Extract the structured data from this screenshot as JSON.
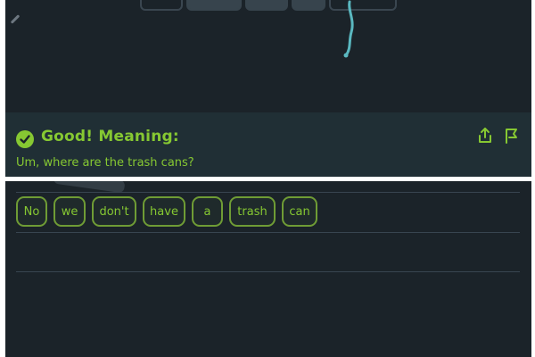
{
  "feedback": {
    "title": "Good! Meaning:",
    "meaning": "Um, where are the trash cans?"
  },
  "word_bank": {
    "words": [
      "No",
      "we",
      "don't",
      "have",
      "a",
      "trash",
      "can"
    ]
  },
  "icons": {
    "check": "check-circle-icon",
    "share": "share-icon",
    "report": "flag-icon"
  },
  "colors": {
    "accent": "#86c832",
    "background": "#1b2329",
    "feedback_bg": "#202f35",
    "swipe": "#5ab8c0"
  }
}
